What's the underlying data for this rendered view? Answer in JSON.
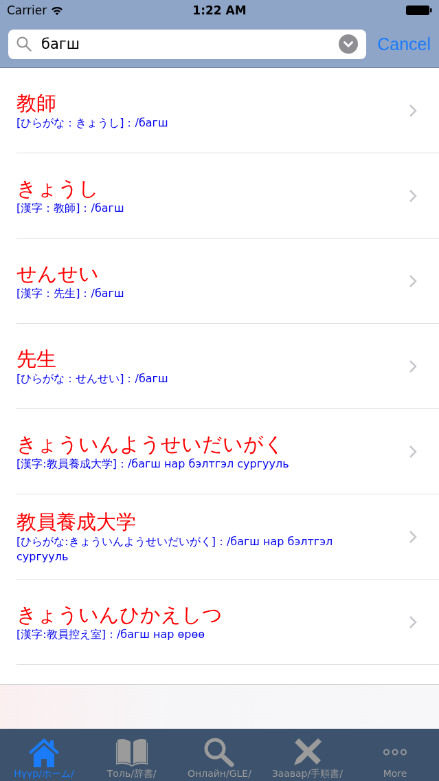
{
  "status_bar": {
    "carrier": "Carrier",
    "time": "1:22 AM"
  },
  "search": {
    "value": "багш",
    "cancel": "Cancel"
  },
  "results": [
    {
      "word": "教師",
      "gloss": "[ひらがな：きょうし]：/багш"
    },
    {
      "word": "きょうし",
      "gloss": "[漢字：教師]：/багш"
    },
    {
      "word": "せんせい",
      "gloss": "[漢字：先生]：/багш"
    },
    {
      "word": "先生",
      "gloss": "[ひらがな：せんせい]：/багш"
    },
    {
      "word": "きょういんようせいだいがく",
      "gloss": "[漢字:教員養成大学]：/багш нар бэлтгэл сургууль"
    },
    {
      "word": "教員養成大学",
      "gloss": "[ひらがな:きょういんようせいだいがく]：/багш нар бэлтгэл сургууль"
    },
    {
      "word": "きょういんひかえしつ",
      "gloss": "[漢字:教員控え室]：/багш нар өрөө"
    }
  ],
  "tab_bar": [
    {
      "label": "Нүүр/ホーム/",
      "selected": true
    },
    {
      "label": "Толь/辞書/",
      "selected": false
    },
    {
      "label": "Онлайн/GLE/",
      "selected": false
    },
    {
      "label": "Заавар/手順書/",
      "selected": false
    },
    {
      "label": "More",
      "selected": false
    }
  ]
}
